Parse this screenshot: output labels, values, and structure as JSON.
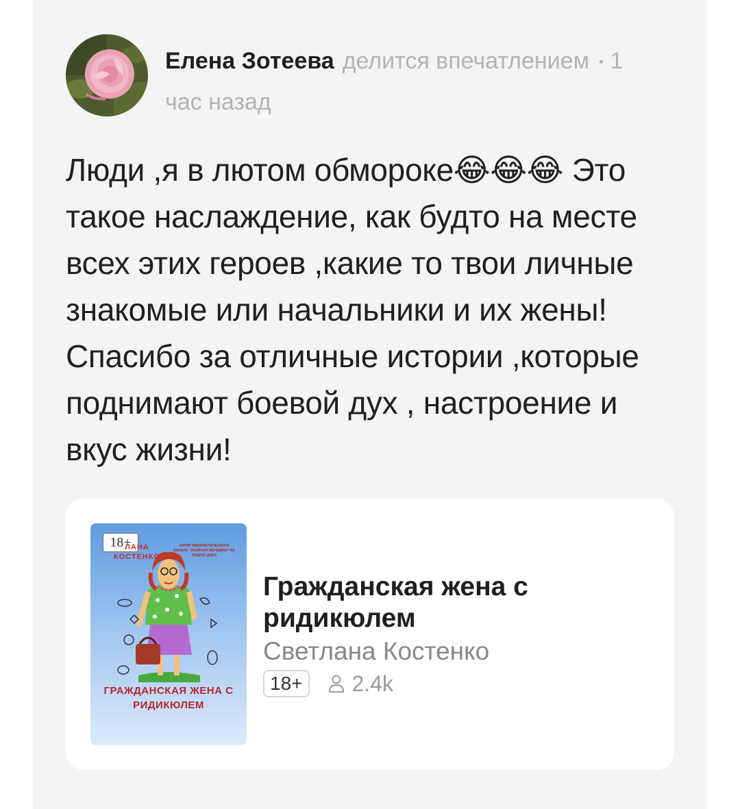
{
  "post": {
    "author_name": "Елена Зотеева",
    "action": "делится впечатлением",
    "dot": "•",
    "time": "1 час назад",
    "text": "Люди ,я в лютом обмороке😂😂😂 Это такое наслаждение, как будто на месте всех этих героев ,какие то твои личные знакомые или начальники и их жены! Спасибо за отличные истории ,которые поднимают боевой дух , настроение и вкус жизни!"
  },
  "book": {
    "title": "Гражданская жена с ридикюлем",
    "author": "Светлана Костенко",
    "age_rating": "18+",
    "views": "2.4k",
    "views_icon": "person-icon",
    "cover": {
      "age_label": "18+",
      "author_text": "ЛАНА КОСТЕНКО",
      "note_text": "АВТОР ЮМОРИСТИЧЕСКОГО КАНАЛА \"ЗНОЙНАЯ ЖЕНЩИНА\" НА ЯНДЕКС.ДЗЕН",
      "title_text": "ГРАЖДАНСКАЯ ЖЕНА С РИДИКЮЛЕМ"
    }
  },
  "colors": {
    "panel_bg": "#f4f4f4",
    "card_bg": "#ffffff",
    "muted_text": "#b3b3b3",
    "main_text": "#202020"
  }
}
